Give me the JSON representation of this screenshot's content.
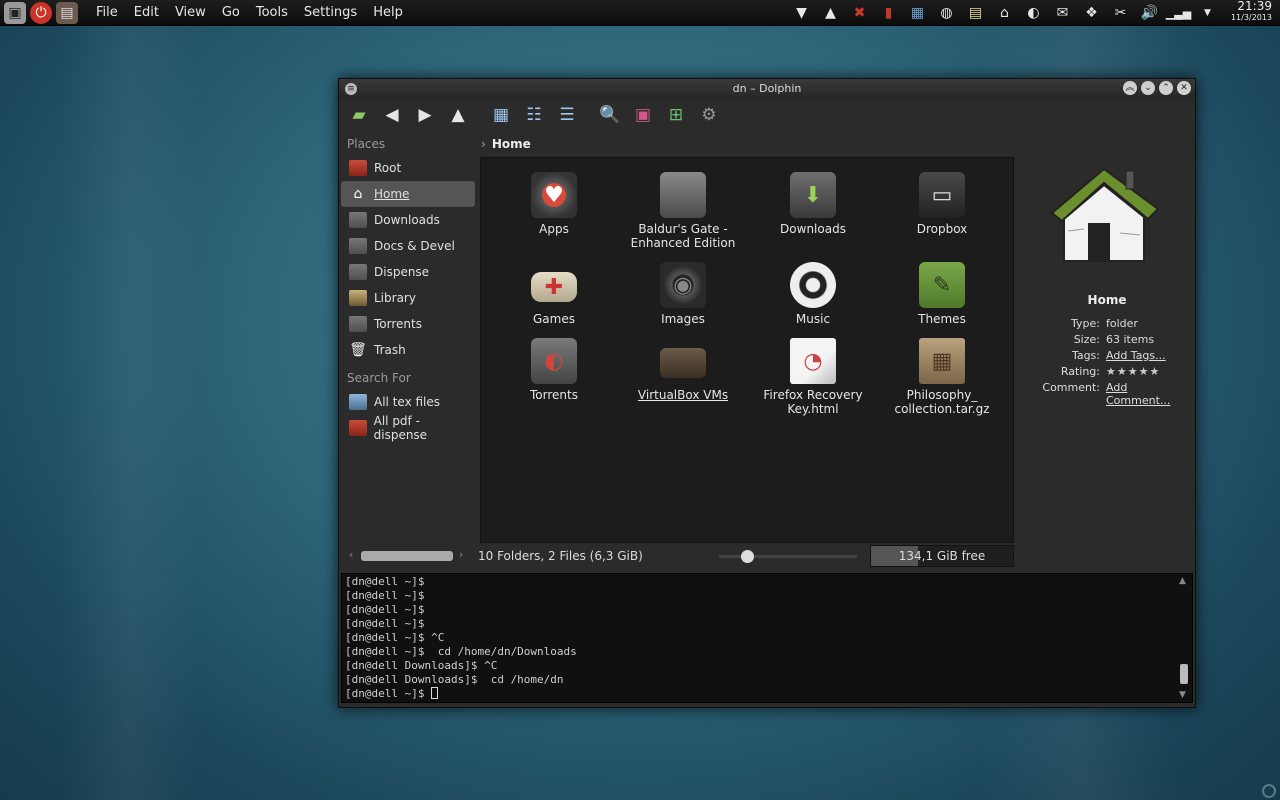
{
  "panel": {
    "menus": [
      "File",
      "Edit",
      "View",
      "Go",
      "Tools",
      "Settings",
      "Help"
    ],
    "clock_time": "21:39",
    "clock_date": "11/3/2013"
  },
  "window": {
    "title": "dn – Dolphin"
  },
  "places": {
    "title": "Places",
    "items": [
      {
        "label": "Root",
        "icon": "red-folder-icon"
      },
      {
        "label": "Home",
        "icon": "home-icon",
        "selected": true
      },
      {
        "label": "Downloads",
        "icon": "folder-icon"
      },
      {
        "label": "Docs & Devel",
        "icon": "folder-icon"
      },
      {
        "label": "Dispense",
        "icon": "folder-icon"
      },
      {
        "label": "Library",
        "icon": "books-icon"
      },
      {
        "label": "Torrents",
        "icon": "folder-icon"
      },
      {
        "label": "Trash",
        "icon": "trash-icon"
      }
    ],
    "search_title": "Search For",
    "searches": [
      {
        "label": "All tex files",
        "icon": "tex-icon"
      },
      {
        "label": "All pdf - dispense",
        "icon": "pdf-icon"
      }
    ]
  },
  "breadcrumb": {
    "current": "Home"
  },
  "files": [
    {
      "name": "Apps",
      "icon": "apps-heart-icon"
    },
    {
      "name": "Baldur's Gate - Enhanced Edition",
      "icon": "folder-icon"
    },
    {
      "name": "Downloads",
      "icon": "downloads-icon"
    },
    {
      "name": "Dropbox",
      "icon": "dropbox-icon"
    },
    {
      "name": "Games",
      "icon": "gamepad-icon"
    },
    {
      "name": "Images",
      "icon": "camera-icon"
    },
    {
      "name": "Music",
      "icon": "music-icon"
    },
    {
      "name": "Themes",
      "icon": "themes-icon"
    },
    {
      "name": "Torrents",
      "icon": "torrents-icon"
    },
    {
      "name": "VirtualBox VMs",
      "icon": "suitcase-icon"
    },
    {
      "name": "Firefox Recovery Key.html",
      "icon": "html-file-icon"
    },
    {
      "name": "Philosophy_ collection.tar.gz",
      "icon": "archive-icon"
    }
  ],
  "info": {
    "title": "Home",
    "type_label": "Type:",
    "type": "folder",
    "size_label": "Size:",
    "size": "63 items",
    "tags_label": "Tags:",
    "tags": "Add Tags...",
    "rating_label": "Rating:",
    "rating": "★★★★★",
    "comment_label": "Comment:",
    "comment": "Add Comment..."
  },
  "status": {
    "text": "10 Folders, 2 Files (6,3 GiB)",
    "free": "134,1 GiB free",
    "used_fraction": 0.33
  },
  "terminal": {
    "lines": [
      "[dn@dell ~]$",
      "[dn@dell ~]$",
      "[dn@dell ~]$",
      "[dn@dell ~]$",
      "[dn@dell ~]$ ^C",
      "[dn@dell ~]$  cd /home/dn/Downloads",
      "[dn@dell Downloads]$ ^C",
      "[dn@dell Downloads]$  cd /home/dn"
    ],
    "prompt": "[dn@dell ~]$ "
  }
}
